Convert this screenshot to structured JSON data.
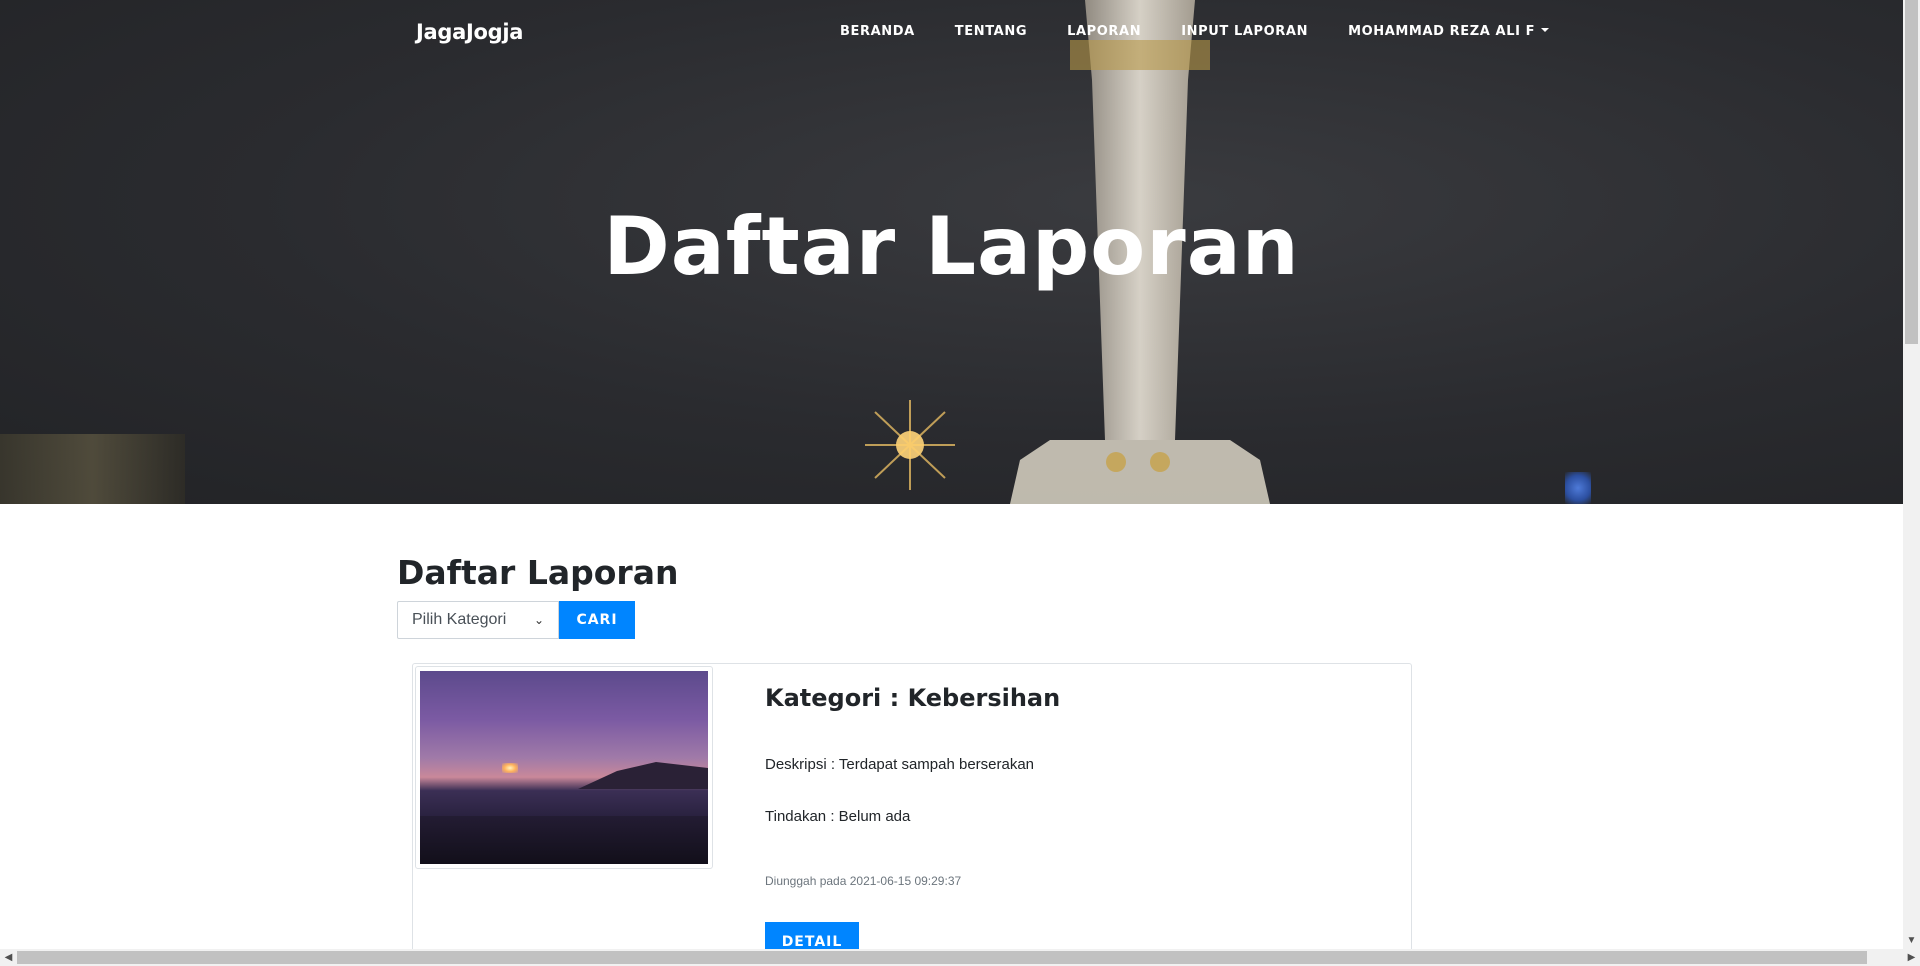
{
  "navbar": {
    "brand": "JagaJogja",
    "links": [
      {
        "label": "BERANDA"
      },
      {
        "label": "TENTANG"
      },
      {
        "label": "LAPORAN"
      },
      {
        "label": "INPUT LAPORAN"
      },
      {
        "label": "MOHAMMAD REZA ALI F"
      }
    ]
  },
  "hero": {
    "title": "Daftar Laporan"
  },
  "main": {
    "title": "Daftar Laporan",
    "filter": {
      "select_value": "Pilih Kategori",
      "search_button": "CARI"
    },
    "reports": [
      {
        "title": "Kategori : Kebersihan",
        "description": "Deskripsi : Terdapat sampah berserakan",
        "action": "Tindakan : Belum ada",
        "uploaded": "Diunggah pada 2021-06-15 09:29:37",
        "detail_button": "DETAIL"
      }
    ]
  },
  "colors": {
    "primary": "#0085ff",
    "hero_bg": "#2a2b2f",
    "text": "#212529"
  }
}
